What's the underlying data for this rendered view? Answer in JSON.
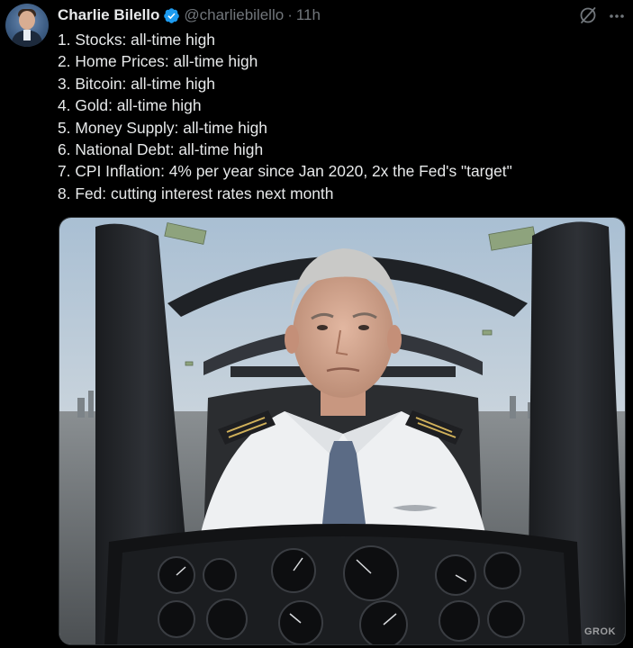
{
  "author": {
    "name": "Charlie Bilello",
    "handle": "@charliebilello",
    "separator": "·",
    "time": "11h",
    "verified": true
  },
  "icons": {
    "verified": "verified-badge-icon",
    "grok": "grok-icon",
    "more": "more-options-icon"
  },
  "tweet": {
    "lines": [
      "1. Stocks: all-time high",
      "2. Home Prices: all-time high",
      "3. Bitcoin: all-time high",
      "4. Gold: all-time high",
      "5. Money Supply: all-time high",
      "6. National Debt: all-time high",
      "7. CPI Inflation: 4% per year since Jan 2020, 2x the Fed's \"target\"",
      "8. Fed: cutting interest rates next month"
    ]
  },
  "media": {
    "description_icon": "ai-image-pilot-in-cockpit",
    "watermark": "GROK"
  },
  "colors": {
    "background": "#000000",
    "text": "#e7e9ea",
    "muted": "#71767b",
    "verified": "#1d9bf0"
  }
}
